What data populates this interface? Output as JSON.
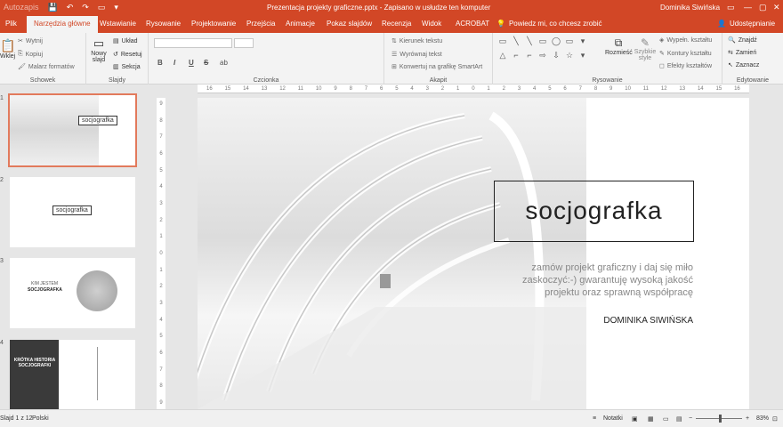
{
  "titlebar": {
    "title": "Prezentacja projekty graficzne.pptx  -  Zapisano w usłudze ten komputer",
    "user": "Dominika Siwińska",
    "qat": [
      "Autozapis",
      "💾",
      "↶",
      "↷",
      "▭",
      "▾"
    ],
    "window_buttons": [
      "▭",
      "—",
      "▢",
      "✕"
    ]
  },
  "tabs": [
    "Plik",
    "Narzędzia główne",
    "Wstawianie",
    "Rysowanie",
    "Projektowanie",
    "Przejścia",
    "Animacje",
    "Pokaz slajdów",
    "Recenzja",
    "Widok",
    "ACROBAT"
  ],
  "tell_me": "Powiedz mi, co chcesz zrobić",
  "share": "Udostępnianie",
  "ribbon": {
    "groups": [
      "Schowek",
      "Slajdy",
      "Czcionka",
      "Akapit",
      "Rysowanie",
      "Edytowanie"
    ],
    "clipboard": {
      "paste": "Wklej",
      "cut": "Wytnij",
      "copy": "Kopiuj",
      "format_painter": "Malarz formatów"
    },
    "slides": {
      "new_slide_1": "Nowy",
      "new_slide_2": "slajd",
      "layout": "Układ",
      "reset": "Resetuj",
      "section": "Sekcja"
    },
    "font": {
      "bold": "B",
      "italic": "I",
      "underline": "U",
      "strike": "S",
      "shadow": "ab"
    },
    "paragraph": {
      "text_direction": "Kierunek tekstu",
      "align_text": "Wyrównaj tekst",
      "smartart": "Konwertuj na grafikę SmartArt"
    },
    "drawing": {
      "arrange": "Rozmieść",
      "styles_1": "Szybkie",
      "styles_2": "style",
      "fill": "Wypełn. kształtu",
      "outline": "Kontury kształtu",
      "effects": "Efekty kształtów"
    },
    "editing": {
      "find": "Znajdź",
      "replace": "Zamień",
      "select": "Zaznacz"
    },
    "shapes": [
      "▭",
      "╲",
      "╲",
      "▭",
      "◯",
      "▭",
      "▾",
      "△",
      "⌐",
      "⌐",
      "⇨",
      "⇩",
      "☆",
      "▾"
    ]
  },
  "ruler_h": [
    "16",
    "15",
    "14",
    "13",
    "12",
    "11",
    "10",
    "9",
    "8",
    "7",
    "6",
    "5",
    "4",
    "3",
    "2",
    "1",
    "0",
    "1",
    "2",
    "3",
    "4",
    "5",
    "6",
    "7",
    "8",
    "9",
    "10",
    "11",
    "12",
    "13",
    "14",
    "15",
    "16"
  ],
  "ruler_v": [
    "9",
    "8",
    "7",
    "6",
    "5",
    "4",
    "3",
    "2",
    "1",
    "0",
    "1",
    "2",
    "3",
    "4",
    "5",
    "6",
    "7",
    "8",
    "9"
  ],
  "thumbnails": [
    {
      "num": "1",
      "logo": "socjografka"
    },
    {
      "num": "2",
      "logo": "socjografka"
    },
    {
      "num": "3",
      "heading": "KIM JESTEM",
      "brand": "SOCJOGRAFKA"
    },
    {
      "num": "4",
      "heading": "KRÓTKA HISTORIA SOCJOGRAFKI"
    }
  ],
  "slide": {
    "logo": "socjografka",
    "tagline_1": "zamów projekt graficzny i daj się miło",
    "tagline_2": "zaskoczyć:-) gwarantuję wysoką jakość",
    "tagline_3": "projektu oraz sprawną współpracę",
    "author": "DOMINIKA SIWIŃSKA"
  },
  "statusbar": {
    "slide_info": "Slajd 1 z 12",
    "language": "Polski",
    "notes": "Notatki",
    "zoom": "83%"
  }
}
